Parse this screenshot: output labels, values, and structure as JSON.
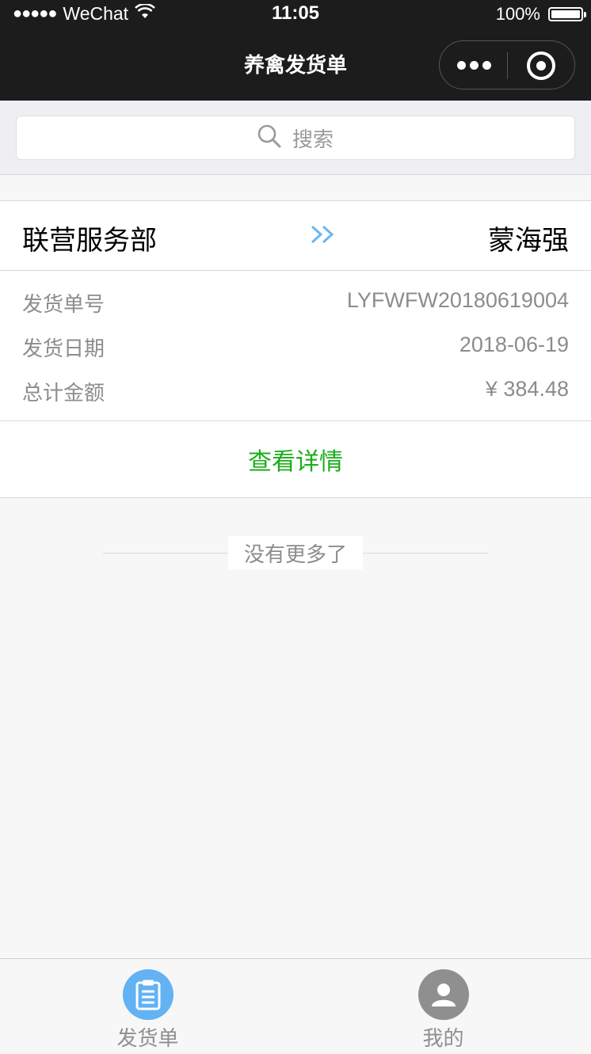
{
  "status_bar": {
    "signal": "●●●●●",
    "carrier": "WeChat",
    "time": "11:05",
    "battery_text": "100%",
    "battery_level": 1.0
  },
  "nav": {
    "title": "养禽发货单",
    "more_icon": "more-dots-icon",
    "close_icon": "miniprogram-close-icon"
  },
  "search": {
    "placeholder": "搜索",
    "icon": "search-icon"
  },
  "order": {
    "from": "联营服务部",
    "to": "蒙海强",
    "arrow_icon": "double-chevron-right-icon",
    "fields": [
      {
        "label": "发货单号",
        "value": "LYFWFW20180619004"
      },
      {
        "label": "发货日期",
        "value": "2018-06-19"
      },
      {
        "label": "总计金额",
        "value": "¥ 384.48"
      }
    ],
    "detail_label": "查看详情"
  },
  "list_end": "没有更多了",
  "tabbar": {
    "tabs": [
      {
        "label": "发货单",
        "icon": "clipboard-icon",
        "active": true
      },
      {
        "label": "我的",
        "icon": "user-icon",
        "active": false
      }
    ]
  },
  "colors": {
    "nav_bg": "#1c1c1c",
    "accent_green": "#1aad19",
    "tab_active": "#62b2f4",
    "tab_inactive": "#8f8f8f",
    "arrow_blue": "#6ab7ef"
  }
}
